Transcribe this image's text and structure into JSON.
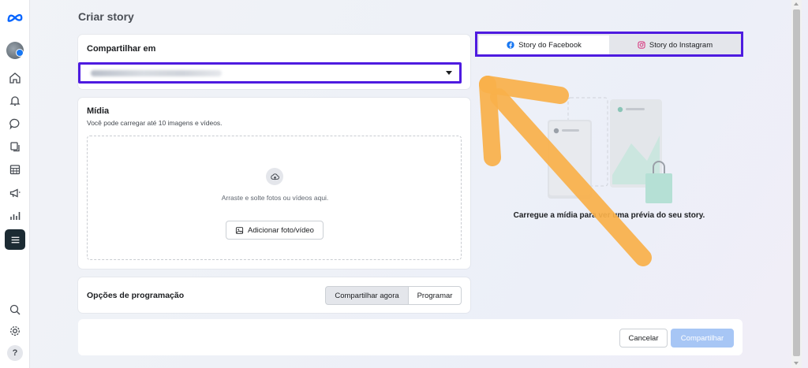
{
  "page": {
    "title": "Criar story"
  },
  "share_on": {
    "title": "Compartilhar em",
    "selected_account": "Página de exemplo (desfocado)"
  },
  "media": {
    "title": "Mídia",
    "subtitle": "Você pode carregar até 10 imagens e vídeos.",
    "drop_text": "Arraste e solte fotos ou vídeos aqui.",
    "add_button": "Adicionar foto/vídeo"
  },
  "schedule": {
    "title": "Opções de programação",
    "options": [
      "Compartilhar agora",
      "Programar"
    ],
    "selected": "Compartilhar agora"
  },
  "preview": {
    "tabs": [
      "Story do Facebook",
      "Story do Instagram"
    ],
    "selected_tab": "Story do Facebook",
    "message": "Carregue a mídia para ver uma prévia do seu story."
  },
  "footer": {
    "cancel": "Cancelar",
    "share": "Compartilhar"
  },
  "colors": {
    "highlight": "#4e1be0",
    "arrow": "#f9b04a",
    "facebook": "#1877f2",
    "disabled_button": "#a7c6f5"
  },
  "icons": [
    "meta-logo-icon",
    "home-icon",
    "bell-icon",
    "chat-icon",
    "pages-icon",
    "calendar-icon",
    "megaphone-icon",
    "insights-icon",
    "menu-icon",
    "search-icon",
    "settings-icon",
    "help-icon"
  ]
}
